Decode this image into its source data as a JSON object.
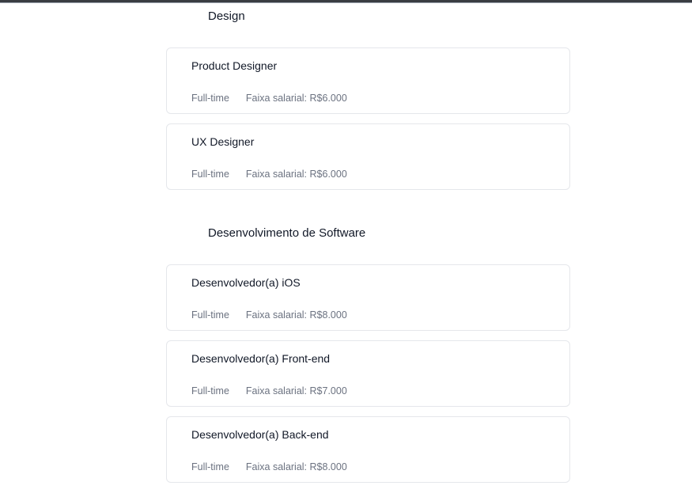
{
  "sections": [
    {
      "title": "Design",
      "jobs": [
        {
          "title": "Product Designer",
          "type": "Full-time",
          "salary_label": "Faixa salarial:",
          "salary": "R$6.000"
        },
        {
          "title": "UX Designer",
          "type": "Full-time",
          "salary_label": "Faixa salarial:",
          "salary": "R$6.000"
        }
      ]
    },
    {
      "title": "Desenvolvimento de Software",
      "jobs": [
        {
          "title": "Desenvolvedor(a) iOS",
          "type": "Full-time",
          "salary_label": "Faixa salarial:",
          "salary": "R$8.000"
        },
        {
          "title": "Desenvolvedor(a) Front-end",
          "type": "Full-time",
          "salary_label": "Faixa salarial:",
          "salary": "R$7.000"
        },
        {
          "title": "Desenvolvedor(a) Back-end",
          "type": "Full-time",
          "salary_label": "Faixa salarial:",
          "salary": "R$8.000"
        }
      ]
    }
  ],
  "colors": {
    "card_border": "#e5e7eb",
    "meta_text": "#6b7280",
    "title_text": "#111827"
  }
}
